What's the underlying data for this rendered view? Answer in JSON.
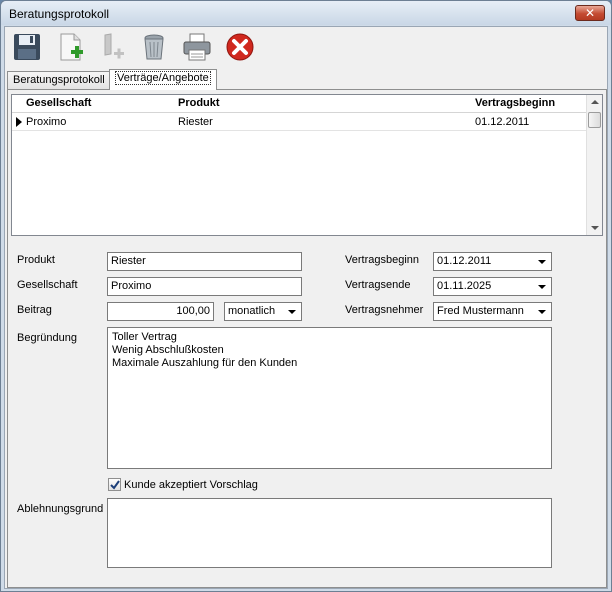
{
  "window": {
    "title": "Beratungsprotokoll",
    "close_glyph": "✕"
  },
  "toolbar": {
    "buttons": [
      {
        "name": "save",
        "icon": "floppy-disk-icon"
      },
      {
        "name": "new",
        "icon": "new-document-icon"
      },
      {
        "name": "new-disabled",
        "icon": "new-item-disabled-icon"
      },
      {
        "name": "delete",
        "icon": "trash-can-icon"
      },
      {
        "name": "print",
        "icon": "printer-icon"
      },
      {
        "name": "cancel",
        "icon": "red-x-circle-icon"
      }
    ]
  },
  "tabs": [
    {
      "label": "Beratungsprotokoll",
      "active": false
    },
    {
      "label": "Verträge/Angebote",
      "active": true
    }
  ],
  "grid": {
    "columns": [
      "Gesellschaft",
      "Produkt",
      "Vertragsbeginn"
    ],
    "rows": [
      {
        "gesellschaft": "Proximo",
        "produkt": "Riester",
        "vertragsbeginn": "01.12.2011"
      }
    ]
  },
  "form": {
    "produkt": {
      "label": "Produkt",
      "value": "Riester"
    },
    "gesellschaft": {
      "label": "Gesellschaft",
      "value": "Proximo"
    },
    "beitrag": {
      "label": "Beitrag",
      "value": "100,00",
      "interval": "monatlich"
    },
    "vertragsbeginn": {
      "label": "Vertragsbeginn",
      "value": "01.12.2011"
    },
    "vertragsende": {
      "label": "Vertragsende",
      "value": "01.11.2025"
    },
    "vertragsnehmer": {
      "label": "Vertragsnehmer",
      "value": "Fred Mustermann"
    },
    "begruendung": {
      "label": "Begründung",
      "lines": [
        "Toller Vertrag",
        "Wenig Abschlußkosten",
        "Maximale Auszahlung für den Kunden"
      ]
    },
    "akzeptiert": {
      "label": "Kunde akzeptiert Vorschlag",
      "checked": true
    },
    "ablehnungsgrund": {
      "label": "Ablehnungsgrund",
      "value": ""
    }
  },
  "colors": {
    "accent_red": "#d0281e",
    "add_green": "#2f9a2a",
    "titlebar": "#c9d7e6"
  }
}
